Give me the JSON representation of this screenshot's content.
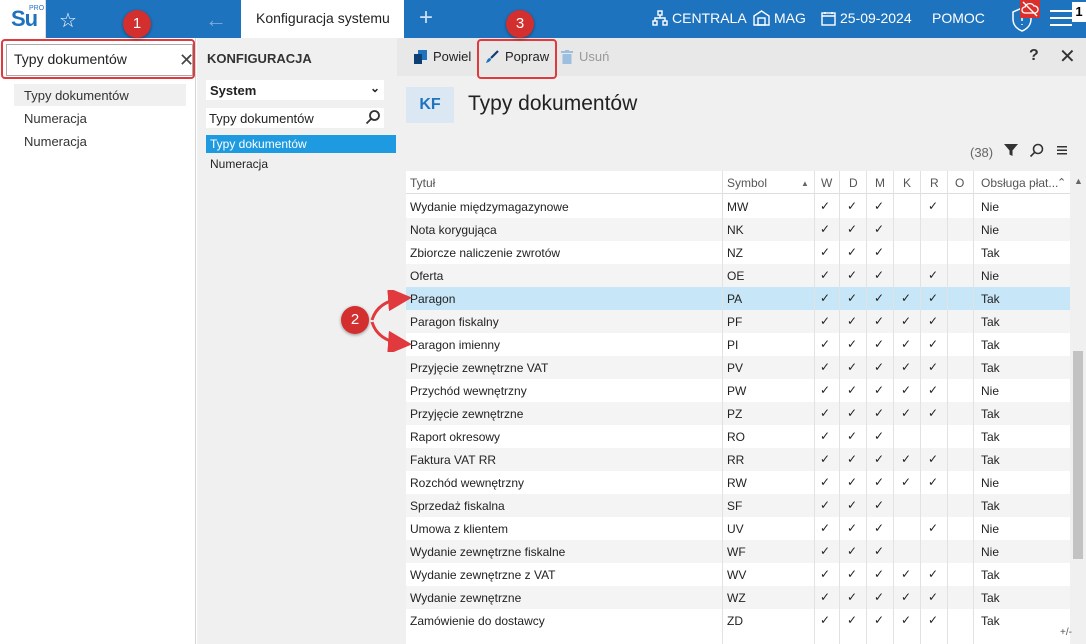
{
  "topbar": {
    "logo_text": "Su",
    "logo_sub": "PRO",
    "active_tab": "Konfiguracja systemu",
    "centrala": "CENTRALA",
    "mag": "MAG",
    "date": "25-09-2024",
    "help": "POMOC",
    "counter": "1"
  },
  "left": {
    "search_value": "Typy dokumentów",
    "items": [
      "Typy dokumentów",
      "Numeracja",
      "Numeracja"
    ]
  },
  "mid": {
    "heading": "KONFIGURACJA",
    "select_value": "System",
    "search_value": "Typy dokumentów",
    "items": [
      "Typy dokumentów",
      "Numeracja"
    ]
  },
  "toolbar": {
    "copy_label": "Powiel",
    "edit_label": "Popraw",
    "delete_label": "Usuń",
    "help": "?",
    "close": "✕"
  },
  "main": {
    "badge": "KF",
    "title": "Typy dokumentów",
    "count": "(38)"
  },
  "grid": {
    "columns": [
      "Tytuł",
      "Symbol",
      "W",
      "D",
      "M",
      "K",
      "R",
      "O",
      "Obsługa płat..."
    ],
    "rows": [
      {
        "t": "Wydanie międzymagazynowe",
        "s": "MW",
        "w": "✓",
        "d": "✓",
        "m": "✓",
        "k": "",
        "r": "✓",
        "o": "",
        "p": "Nie"
      },
      {
        "t": "Nota korygująca",
        "s": "NK",
        "w": "✓",
        "d": "✓",
        "m": "✓",
        "k": "",
        "r": "",
        "o": "",
        "p": "Nie"
      },
      {
        "t": "Zbiorcze naliczenie zwrotów",
        "s": "NZ",
        "w": "✓",
        "d": "✓",
        "m": "✓",
        "k": "",
        "r": "",
        "o": "",
        "p": "Tak"
      },
      {
        "t": "Oferta",
        "s": "OE",
        "w": "✓",
        "d": "✓",
        "m": "✓",
        "k": "",
        "r": "✓",
        "o": "",
        "p": "Nie"
      },
      {
        "t": "Paragon",
        "s": "PA",
        "w": "✓",
        "d": "✓",
        "m": "✓",
        "k": "✓",
        "r": "✓",
        "o": "",
        "p": "Tak"
      },
      {
        "t": "Paragon fiskalny",
        "s": "PF",
        "w": "✓",
        "d": "✓",
        "m": "✓",
        "k": "✓",
        "r": "✓",
        "o": "",
        "p": "Tak"
      },
      {
        "t": "Paragon imienny",
        "s": "PI",
        "w": "✓",
        "d": "✓",
        "m": "✓",
        "k": "✓",
        "r": "✓",
        "o": "",
        "p": "Tak"
      },
      {
        "t": "Przyjęcie zewnętrzne VAT",
        "s": "PV",
        "w": "✓",
        "d": "✓",
        "m": "✓",
        "k": "✓",
        "r": "✓",
        "o": "",
        "p": "Tak"
      },
      {
        "t": "Przychód wewnętrzny",
        "s": "PW",
        "w": "✓",
        "d": "✓",
        "m": "✓",
        "k": "✓",
        "r": "✓",
        "o": "",
        "p": "Nie"
      },
      {
        "t": "Przyjęcie zewnętrzne",
        "s": "PZ",
        "w": "✓",
        "d": "✓",
        "m": "✓",
        "k": "✓",
        "r": "✓",
        "o": "",
        "p": "Tak"
      },
      {
        "t": "Raport okresowy",
        "s": "RO",
        "w": "✓",
        "d": "✓",
        "m": "✓",
        "k": "",
        "r": "",
        "o": "",
        "p": "Tak"
      },
      {
        "t": "Faktura VAT RR",
        "s": "RR",
        "w": "✓",
        "d": "✓",
        "m": "✓",
        "k": "✓",
        "r": "✓",
        "o": "",
        "p": "Tak"
      },
      {
        "t": "Rozchód wewnętrzny",
        "s": "RW",
        "w": "✓",
        "d": "✓",
        "m": "✓",
        "k": "✓",
        "r": "✓",
        "o": "",
        "p": "Nie"
      },
      {
        "t": "Sprzedaż fiskalna",
        "s": "SF",
        "w": "✓",
        "d": "✓",
        "m": "✓",
        "k": "",
        "r": "",
        "o": "",
        "p": "Tak"
      },
      {
        "t": "Umowa z klientem",
        "s": "UV",
        "w": "✓",
        "d": "✓",
        "m": "✓",
        "k": "",
        "r": "✓",
        "o": "",
        "p": "Nie"
      },
      {
        "t": "Wydanie zewnętrzne fiskalne",
        "s": "WF",
        "w": "✓",
        "d": "✓",
        "m": "✓",
        "k": "",
        "r": "",
        "o": "",
        "p": "Nie"
      },
      {
        "t": "Wydanie zewnętrzne z VAT",
        "s": "WV",
        "w": "✓",
        "d": "✓",
        "m": "✓",
        "k": "✓",
        "r": "✓",
        "o": "",
        "p": "Tak"
      },
      {
        "t": "Wydanie zewnętrzne",
        "s": "WZ",
        "w": "✓",
        "d": "✓",
        "m": "✓",
        "k": "✓",
        "r": "✓",
        "o": "",
        "p": "Tak"
      },
      {
        "t": "Zamówienie do dostawcy",
        "s": "ZD",
        "w": "✓",
        "d": "✓",
        "m": "✓",
        "k": "✓",
        "r": "✓",
        "o": "",
        "p": "Tak"
      }
    ],
    "selected_index": 4,
    "plusminus": "+/-"
  },
  "annotations": [
    "1",
    "2",
    "3"
  ],
  "colors": {
    "accent": "#1e73be",
    "selection": "#c7e6f7",
    "annotation": "#d32f2f"
  }
}
